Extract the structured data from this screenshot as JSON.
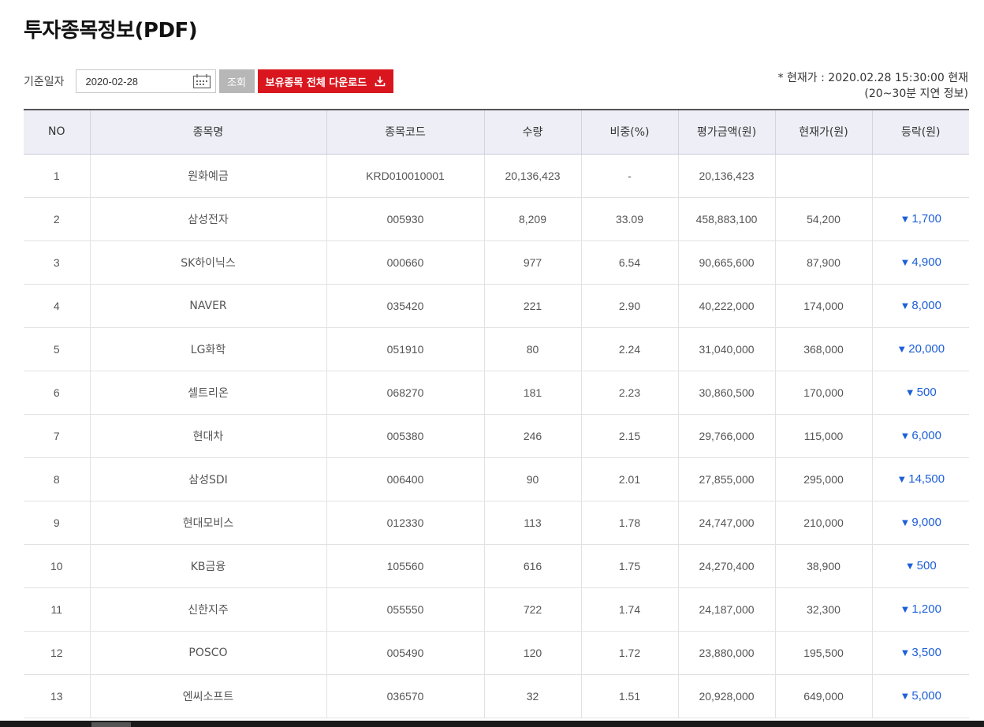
{
  "page_title": "투자종목정보(PDF)",
  "filter": {
    "label": "기준일자",
    "date_value": "2020-02-28",
    "search_label": "조회",
    "download_label": "보유종목 전체 다운로드"
  },
  "asof": {
    "line1": "* 현재가 :  2020.02.28 15:30:00 현재",
    "line2": "(20~30분 지연 정보)"
  },
  "table": {
    "headers": [
      "NO",
      "종목명",
      "종목코드",
      "수량",
      "비중(%)",
      "평가금액(원)",
      "현재가(원)",
      "등락(원)"
    ],
    "rows": [
      {
        "no": "1",
        "name": "원화예금",
        "code": "KRD010010001",
        "qty": "20,136,423",
        "weight": "-",
        "value": "20,136,423",
        "price": "",
        "change": ""
      },
      {
        "no": "2",
        "name": "삼성전자",
        "code": "005930",
        "qty": "8,209",
        "weight": "33.09",
        "value": "458,883,100",
        "price": "54,200",
        "change": "1,700"
      },
      {
        "no": "3",
        "name": "SK하이닉스",
        "code": "000660",
        "qty": "977",
        "weight": "6.54",
        "value": "90,665,600",
        "price": "87,900",
        "change": "4,900"
      },
      {
        "no": "4",
        "name": "NAVER",
        "code": "035420",
        "qty": "221",
        "weight": "2.90",
        "value": "40,222,000",
        "price": "174,000",
        "change": "8,000"
      },
      {
        "no": "5",
        "name": "LG화학",
        "code": "051910",
        "qty": "80",
        "weight": "2.24",
        "value": "31,040,000",
        "price": "368,000",
        "change": "20,000"
      },
      {
        "no": "6",
        "name": "셀트리온",
        "code": "068270",
        "qty": "181",
        "weight": "2.23",
        "value": "30,860,500",
        "price": "170,000",
        "change": "500"
      },
      {
        "no": "7",
        "name": "현대차",
        "code": "005380",
        "qty": "246",
        "weight": "2.15",
        "value": "29,766,000",
        "price": "115,000",
        "change": "6,000"
      },
      {
        "no": "8",
        "name": "삼성SDI",
        "code": "006400",
        "qty": "90",
        "weight": "2.01",
        "value": "27,855,000",
        "price": "295,000",
        "change": "14,500"
      },
      {
        "no": "9",
        "name": "현대모비스",
        "code": "012330",
        "qty": "113",
        "weight": "1.78",
        "value": "24,747,000",
        "price": "210,000",
        "change": "9,000"
      },
      {
        "no": "10",
        "name": "KB금융",
        "code": "105560",
        "qty": "616",
        "weight": "1.75",
        "value": "24,270,400",
        "price": "38,900",
        "change": "500"
      },
      {
        "no": "11",
        "name": "신한지주",
        "code": "055550",
        "qty": "722",
        "weight": "1.74",
        "value": "24,187,000",
        "price": "32,300",
        "change": "1,200"
      },
      {
        "no": "12",
        "name": "POSCO",
        "code": "005490",
        "qty": "120",
        "weight": "1.72",
        "value": "23,880,000",
        "price": "195,500",
        "change": "3,500"
      },
      {
        "no": "13",
        "name": "엔씨소프트",
        "code": "036570",
        "qty": "32",
        "weight": "1.51",
        "value": "20,928,000",
        "price": "649,000",
        "change": "5,000"
      }
    ]
  },
  "icons": {
    "calendar": "calendar-icon",
    "download": "download-icon",
    "down_arrow": "▼"
  },
  "colors": {
    "download_button": "#d9161e",
    "search_button": "#b7b7b7",
    "header_bg": "#eeeef6",
    "change_down": "#1d5fd8"
  }
}
